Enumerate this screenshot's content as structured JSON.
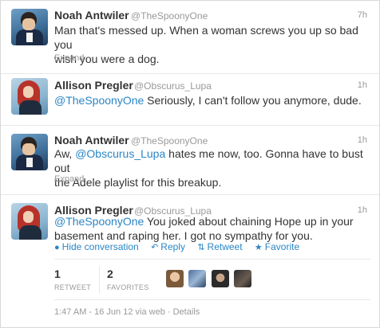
{
  "tweets": [
    {
      "name": "Noah Antwiler",
      "handle": "@TheSpoonyOne",
      "time": "7h",
      "text_line1": "Man that's messed up. When a woman screws you up so bad you",
      "text_line2": "wish you were a dog.",
      "expand": "Expand"
    },
    {
      "name": "Allison Pregler",
      "handle": "@Obscurus_Lupa",
      "time": "1h",
      "mention": "@TheSpoonyOne",
      "text_rest": " Seriously, I can't follow you anymore, dude."
    },
    {
      "name": "Noah Antwiler",
      "handle": "@TheSpoonyOne",
      "time": "1h",
      "text_pre": "Aw, ",
      "mention": "@Obscurus_Lupa",
      "text_post": " hates me now, too. Gonna have to bust out",
      "text_line2": "the Adele playlist for this breakup.",
      "expand": "Expand"
    },
    {
      "name": "Allison Pregler",
      "handle": "@Obscurus_Lupa",
      "time": "1h",
      "mention": "@TheSpoonyOne",
      "text_rest": " You joked about chaining Hope up in your",
      "text_line2": "basement and raping her. I got no sympathy for you.",
      "actions": {
        "hide": "Hide conversation",
        "reply": "Reply",
        "retweet": "Retweet",
        "favorite": "Favorite"
      },
      "stats": {
        "retweets": "1",
        "retweets_label": "RETWEET",
        "favorites": "2",
        "favorites_label": "FAVORITES"
      },
      "meta": "1:47 AM - 16 Jun 12 via web · Details"
    }
  ],
  "icons": {
    "hide": "speech-bubble-icon",
    "reply": "reply-arrow-icon",
    "retweet": "retweet-icon",
    "favorite": "star-icon"
  },
  "colors": {
    "link": "#2a86c5",
    "muted": "#999999",
    "text": "#333333"
  }
}
